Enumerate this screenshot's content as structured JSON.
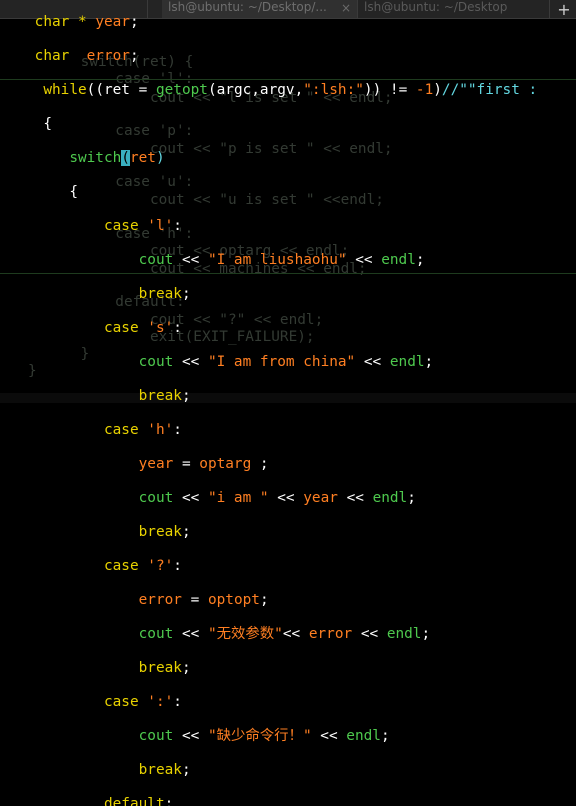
{
  "ghost_window": {
    "tabs": [
      {
        "label": ""
      },
      {
        "label": "lsh@ubuntu: ~/Desktop/..."
      },
      {
        "label": "lsh@ubuntu: ~/Desktop"
      }
    ],
    "new_tab_label": "+",
    "lines": [
      "    switch(ret) {",
      "        case 'l':",
      "            cout << \"l is set \" << endl;",
      "        case 'p':",
      "            cout << \"p is set \" << endl;",
      "        case 'u':",
      "            cout << \"u is set \" <<endl;",
      "        case 'h':",
      "            cout << optarg << endl;",
      "            cout << machines << endl;",
      "        default:",
      "            cout << \"?\" << endl;",
      "            exit(EXIT_FAILURE);",
      "    }",
      "}"
    ]
  },
  "code": {
    "l1": {
      "type": "char * ",
      "name": "year",
      "punct": ";"
    },
    "l2": {
      "type": "char  ",
      "name": "error",
      "punct": ";"
    },
    "l3": {
      "kw": "while",
      "pre": "((ret = ",
      "fn": "getopt",
      "args": "(argc,argv,",
      "str": "\":lsh:\"",
      "mid": ")) != ",
      "num": "-1",
      "close": ")",
      "comment": "//\"\"first :"
    },
    "l4": {
      "text": "{"
    },
    "l5": {
      "kw": "switch",
      "cursor": "(",
      "arg": "ret",
      "close": ")"
    },
    "l6": {
      "text": "{"
    },
    "l7": {
      "kw": "case ",
      "str": "'l'",
      "punct": ":"
    },
    "l8": {
      "obj": "cout",
      "op": " << ",
      "str": "\"I am liushaohu\"",
      "op2": " << ",
      "fn": "endl",
      "punct": ";"
    },
    "l9": {
      "kw": "break",
      "punct": ";"
    },
    "l10": {
      "kw": "case ",
      "str": "'s'",
      "punct": ":"
    },
    "l11": {
      "obj": "cout",
      "op": " << ",
      "str": "\"I am from china\"",
      "op2": " << ",
      "fn": "endl",
      "punct": ";"
    },
    "l12": {
      "kw": "break",
      "punct": ";"
    },
    "l13": {
      "kw": "case ",
      "str": "'h'",
      "punct": ":"
    },
    "l14": {
      "var": "year",
      "op": " = ",
      "val": "optarg",
      "punct": " ;"
    },
    "l15": {
      "obj": "cout",
      "op": " << ",
      "str": "\"i am \"",
      "op2": " << ",
      "var": "year",
      "op3": " << ",
      "fn": "endl",
      "punct": ";"
    },
    "l16": {
      "kw": "break",
      "punct": ";"
    },
    "l17": {
      "kw": "case ",
      "str": "'?'",
      "punct": ":"
    },
    "l18": {
      "var": "error",
      "op": " = ",
      "val": "optopt",
      "punct": ";"
    },
    "l19": {
      "obj": "cout",
      "op": " << ",
      "str": "\"无效参数\"",
      "op2": "<< ",
      "var": "error",
      "op3": " << ",
      "fn": "endl",
      "punct": ";"
    },
    "l20": {
      "kw": "break",
      "punct": ";"
    },
    "l21": {
      "kw": "case ",
      "str": "':'",
      "punct": ":"
    },
    "l22": {
      "obj": "cout",
      "op": " << ",
      "str": "\"缺少命令行！\"",
      "op2": " << ",
      "fn": "endl",
      "punct": ";"
    },
    "l23": {
      "kw": "break",
      "punct": ";"
    },
    "l24": {
      "kw": "default",
      "punct": ":"
    }
  },
  "colors": {
    "keyword": "#e8d200",
    "string": "#ff7f22",
    "function": "#4ec94e",
    "comment": "#62d6e0",
    "cursor": "#3ab0c0",
    "background": "#000000"
  }
}
